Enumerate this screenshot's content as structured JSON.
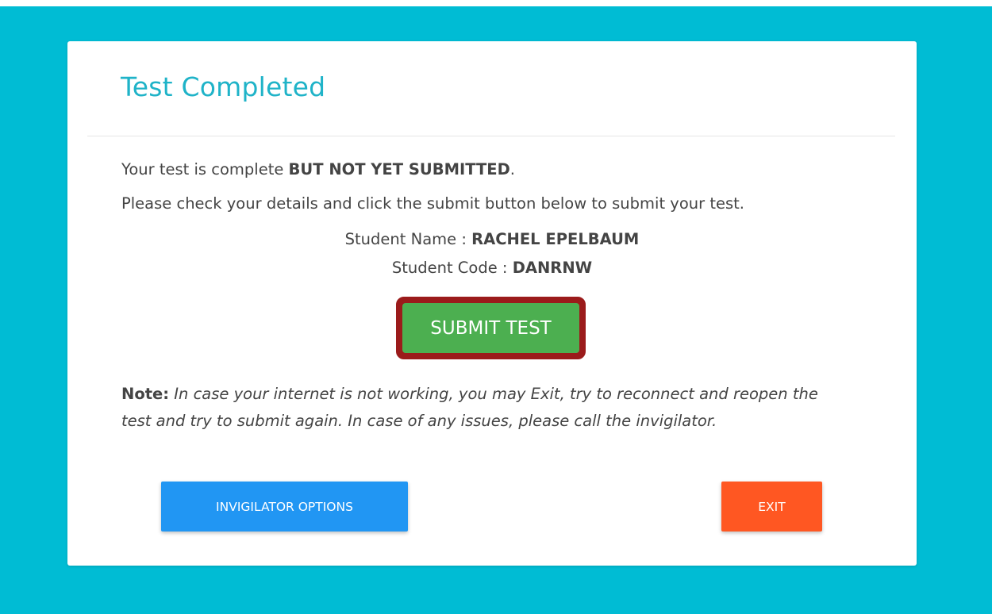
{
  "card": {
    "title": "Test Completed"
  },
  "message": {
    "line1_prefix": "Your test is complete ",
    "line1_bold": "BUT NOT YET SUBMITTED",
    "line1_suffix": ".",
    "line2": "Please check your details and click the submit button below to submit your test."
  },
  "student": {
    "name_label": "Student Name : ",
    "name_value": "RACHEL EPELBAUM",
    "code_label": "Student Code : ",
    "code_value": "DANRNW"
  },
  "actions": {
    "submit_label": "SUBMIT TEST",
    "invigilator_label": "INVIGILATOR OPTIONS",
    "exit_label": "EXIT"
  },
  "note": {
    "label": "Note:",
    "text": "In case your internet is not working, you may Exit, try to reconnect and reopen the test and try to submit again. In case of any issues, please call the invigilator."
  },
  "colors": {
    "background": "#00bcd4",
    "title": "#1fb3c8",
    "submit": "#4caf50",
    "submit_highlight": "#9b1b1b",
    "invigilator": "#2196f3",
    "exit": "#ff5722"
  }
}
